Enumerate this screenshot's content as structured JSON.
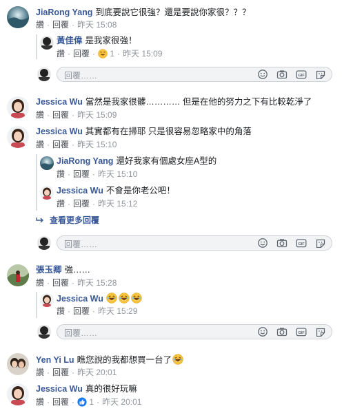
{
  "actions": {
    "like": "讚",
    "reply": "回覆",
    "sep": "·"
  },
  "reply_placeholder": "回覆……",
  "view_more": "查看更多回覆",
  "comments": [
    {
      "name": "JiaRong Yang",
      "text": "到底要說它很強？還是要說你家很？？？",
      "time": "昨天 15:08"
    },
    {
      "name": "黃佳偉",
      "text": "是我家很強！",
      "reaction_count": "1",
      "time": "昨天 15:09"
    },
    {
      "name": "Jessica Wu",
      "text": "當然是我家很髒………… 但是在他的努力之下有比較乾淨了",
      "time": "昨天 15:09"
    },
    {
      "name": "Jessica Wu",
      "text": "其實都有在掃耶 只是很容易忽略家中的角落",
      "time": "昨天 15:10"
    },
    {
      "name": "JiaRong Yang",
      "text": "還好我家有個處女座A型的",
      "time": "昨天 15:10"
    },
    {
      "name": "Jessica Wu",
      "text": "不會是你老公吧！",
      "time": "昨天 15:12"
    },
    {
      "name": "張玉卿",
      "text": "強……",
      "time": "昨天 15:28"
    },
    {
      "name": "Jessica Wu",
      "text": "",
      "time": "昨天 15:29"
    },
    {
      "name": "Yen Yi Lu",
      "text": "瞧您說的我都想買一台了",
      "time": "昨天 20:01"
    },
    {
      "name": "Jessica Wu",
      "text": "真的很好玩嘛",
      "reaction_count": "1",
      "time": "昨天 20:01"
    }
  ],
  "colors": {
    "name": "#385898",
    "meta": "#90949c",
    "border": "#ccd0d5",
    "box_bg": "#f2f3f5"
  }
}
